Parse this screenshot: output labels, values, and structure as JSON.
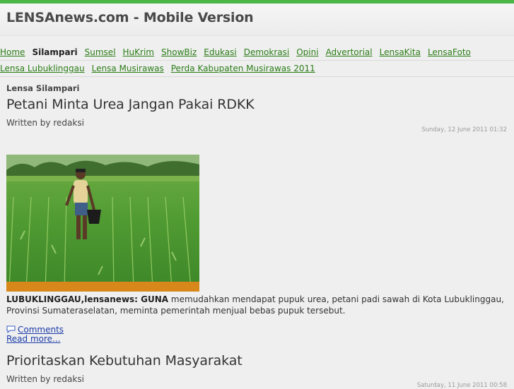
{
  "site": {
    "title": "LENSAnews.com - Mobile Version"
  },
  "nav": {
    "row1": [
      {
        "label": "Home",
        "active": false
      },
      {
        "label": "Silampari",
        "active": true
      },
      {
        "label": "Sumsel",
        "active": false
      },
      {
        "label": "HuKrim",
        "active": false
      },
      {
        "label": "ShowBiz",
        "active": false
      },
      {
        "label": "Edukasi",
        "active": false
      },
      {
        "label": "Demokrasi",
        "active": false
      },
      {
        "label": "Opini",
        "active": false
      },
      {
        "label": "Advertorial",
        "active": false
      },
      {
        "label": "LensaKita",
        "active": false
      },
      {
        "label": "LensaFoto",
        "active": false
      }
    ],
    "row2": [
      {
        "label": "Lensa Lubuklinggau"
      },
      {
        "label": "Lensa Musirawas"
      },
      {
        "label": "Perda Kabupaten Musirawas 2011"
      }
    ]
  },
  "section": {
    "label": "Lensa Silampari"
  },
  "articles": [
    {
      "title": "Petani Minta Urea Jangan Pakai RDKK",
      "byline": "Written by redaksi",
      "date": "Sunday, 12 June 2011 01:32",
      "summary_lead": "LUBUKLINGGAU,lensanews: GUNA",
      "summary_text": " memudahkan mendapat pupuk urea, petani padi sawah di Kota Lubuklinggau, Provinsi Sumateraselatan, meminta pemerintah menjual bebas pupuk tersebut.",
      "comments_label": "Comments",
      "read_more_label": "Read more..."
    },
    {
      "title": "Prioritaskan Kebutuhan Masyarakat",
      "byline": "Written by redaksi",
      "date": "Saturday, 11 June 2011 00:58"
    }
  ],
  "colors": {
    "accent": "#4cb649",
    "link": "#2b7d17",
    "body_link": "#1a3aa8"
  }
}
